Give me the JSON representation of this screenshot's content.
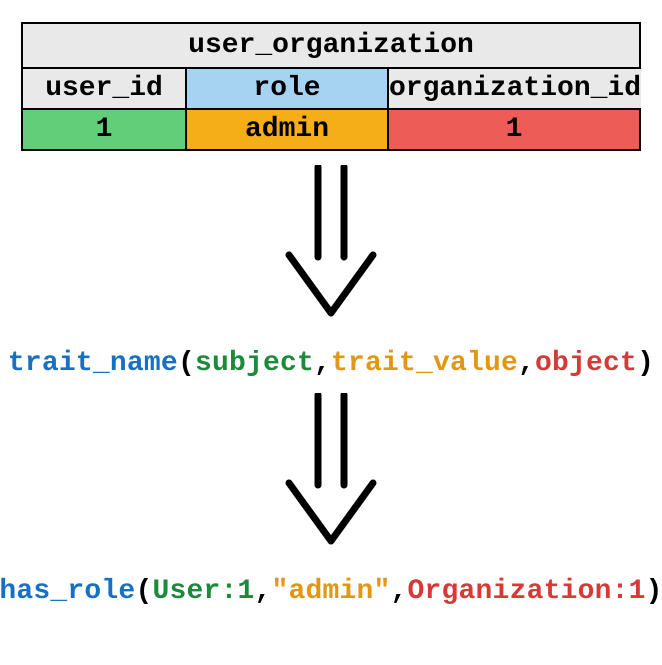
{
  "table": {
    "title": "user_organization",
    "headers": {
      "user": "user_id",
      "role": "role",
      "org": "organization_id"
    },
    "row": {
      "user": "1",
      "role": "admin",
      "org": "1"
    }
  },
  "expr1": {
    "func": "trait_name",
    "open": "(",
    "arg1": "subject",
    "sep1": ",",
    "arg2": "trait_value",
    "sep2": ",",
    "arg3": "object",
    "close": ")"
  },
  "expr2": {
    "func": "has_role",
    "open": "(",
    "arg1": "User:1",
    "sep1": ",",
    "arg2": "\"admin\"",
    "sep2": ",",
    "arg3": "Organization:1",
    "close": ")"
  }
}
